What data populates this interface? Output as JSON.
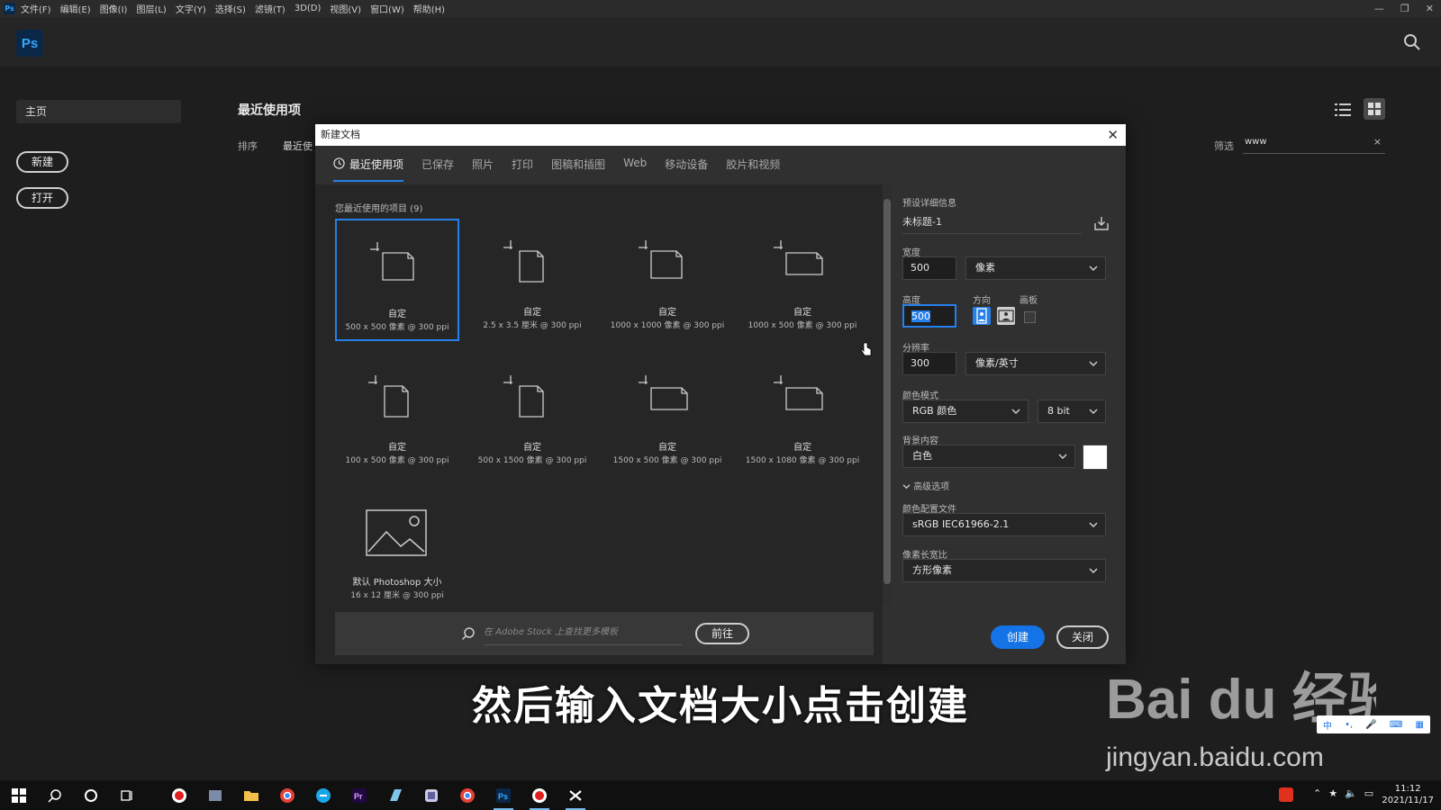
{
  "menubar": {
    "app_icon": "Ps",
    "items": [
      "文件(F)",
      "编辑(E)",
      "图像(I)",
      "图层(L)",
      "文字(Y)",
      "选择(S)",
      "滤镜(T)",
      "3D(D)",
      "视图(V)",
      "窗口(W)",
      "帮助(H)"
    ],
    "window_controls": [
      "minimize-icon",
      "restore-icon",
      "close-icon"
    ]
  },
  "appbar": {
    "logo": "Ps",
    "search_icon": "search-icon"
  },
  "home": {
    "sidebar_home": "主页",
    "new_button": "新建",
    "open_button": "打开",
    "recent_title": "最近使用项",
    "sort_label": "排序",
    "sort_value": "最近使",
    "filter_label": "筛选",
    "filter_value": "www",
    "filter_clear": "×"
  },
  "dialog": {
    "title": "新建文档",
    "close": "✕",
    "tabs": [
      "最近使用项",
      "已保存",
      "照片",
      "打印",
      "图稿和插图",
      "Web",
      "移动设备",
      "胶片和视频"
    ],
    "active_tab": 0,
    "recent_count": "您最近使用的项目 (9)",
    "presets": [
      {
        "name": "自定",
        "dims": "500 x 500 像素 @ 300 ppi",
        "selected": true,
        "shape": "square"
      },
      {
        "name": "自定",
        "dims": "2.5 x 3.5 厘米 @ 300 ppi",
        "selected": false,
        "shape": "portrait"
      },
      {
        "name": "自定",
        "dims": "1000 x 1000 像素 @ 300 ppi",
        "selected": false,
        "shape": "square"
      },
      {
        "name": "自定",
        "dims": "1000 x 500 像素 @ 300 ppi",
        "selected": false,
        "shape": "landscape"
      },
      {
        "name": "自定",
        "dims": "100 x 500 像素 @ 300 ppi",
        "selected": false,
        "shape": "portrait"
      },
      {
        "name": "自定",
        "dims": "500 x 1500 像素 @ 300 ppi",
        "selected": false,
        "shape": "portrait"
      },
      {
        "name": "自定",
        "dims": "1500 x 500 像素 @ 300 ppi",
        "selected": false,
        "shape": "landscape"
      },
      {
        "name": "自定",
        "dims": "1500 x 1080 像素 @ 300 ppi",
        "selected": false,
        "shape": "landscape"
      },
      {
        "name": "默认 Photoshop 大小",
        "dims": "16 x 12 厘米 @ 300 ppi",
        "selected": false,
        "shape": "image"
      }
    ],
    "stock_placeholder": "在 Adobe Stock 上查找更多模板",
    "go_button": "前往",
    "details": {
      "section_label": "预设详细信息",
      "preset_name": "未标题-1",
      "width_label": "宽度",
      "width_value": "500",
      "width_unit": "像素",
      "height_label": "高度",
      "height_value": "500",
      "orientation_label": "方向",
      "artboard_label": "画板",
      "resolution_label": "分辨率",
      "resolution_value": "300",
      "resolution_unit": "像素/英寸",
      "color_mode_label": "颜色模式",
      "color_mode": "RGB 颜色",
      "bit_depth": "8 bit",
      "background_label": "背景内容",
      "background_value": "白色",
      "background_color": "#ffffff",
      "advanced_label": "高级选项",
      "profile_label": "颜色配置文件",
      "profile_value": "sRGB IEC61966-2.1",
      "pixel_aspect_label": "像素长宽比",
      "pixel_aspect_value": "方形像素"
    },
    "create_button": "创建",
    "close_button": "关闭"
  },
  "overlay": {
    "subtitle": "然后输入文档大小点击创建",
    "watermark_logo": "Bai du 经验",
    "watermark_url": "jingyan.baidu.com"
  },
  "taskbar": {
    "time": "11:12",
    "date": "2021/11/17",
    "apps": [
      "start",
      "search",
      "cortana",
      "task-view",
      "record",
      "app",
      "explorer",
      "chrome",
      "browser",
      "premiere",
      "app2",
      "app3",
      "chrome2",
      "photoshop",
      "recorder",
      "capcut"
    ]
  },
  "colors": {
    "accent": "#2680eb",
    "create": "#1473e6",
    "ps_blue": "#31a8ff"
  }
}
